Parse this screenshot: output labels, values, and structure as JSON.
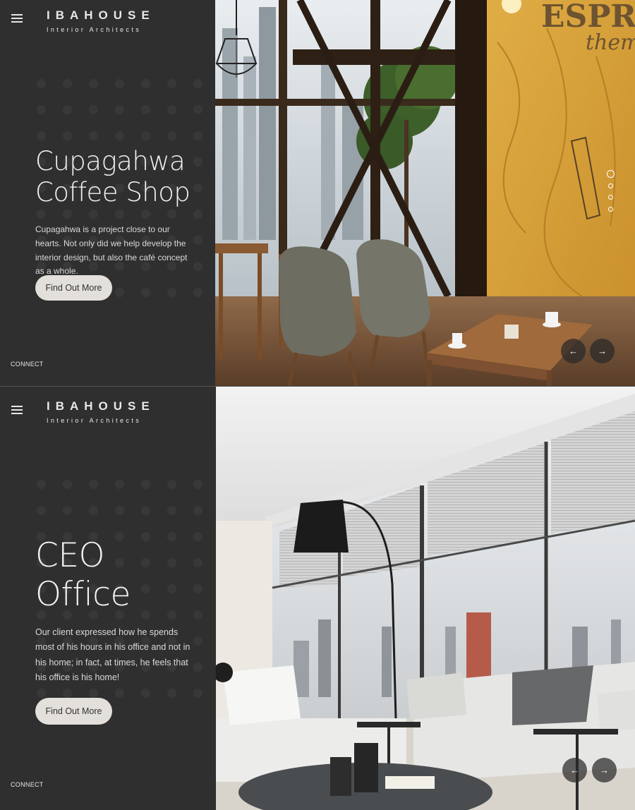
{
  "slides": [
    {
      "logo_main": "IBAHOUSE",
      "logo_sub": "Interior Architects",
      "title_line1": "Cupagahwa",
      "title_line2": "Coffee Shop",
      "description": "Cupagahwa is a project close to our hearts. Not only did we help develop the interior design, but also the café concept as a whole.",
      "button_label": "Find Out More",
      "connect_label": "CONNECT",
      "wall_text_1": "ESPR",
      "wall_text_2": "thems",
      "prev_arrow": "←",
      "next_arrow": "→",
      "active_dot": 1,
      "dot_count": 4
    },
    {
      "logo_main": "IBAHOUSE",
      "logo_sub": "Interior Architects",
      "title_line1": "CEO",
      "title_line2": "Office",
      "description": "Our client expressed how he spends most of his hours in his office and not in his home; in fact, at times, he feels that his office is his home!",
      "button_label": "Find Out More",
      "connect_label": "CONNECT",
      "prev_arrow": "←",
      "next_arrow": "→"
    }
  ],
  "colors": {
    "sidebar": "#2f2f30",
    "button": "#e3dfdb",
    "wall_yellow": "#d9a53a",
    "wood": "#8a5a32"
  },
  "icons": [
    "menu-icon",
    "arrow-left-icon",
    "arrow-right-icon",
    "pendant-lamp-icon",
    "floor-lamp-icon"
  ]
}
